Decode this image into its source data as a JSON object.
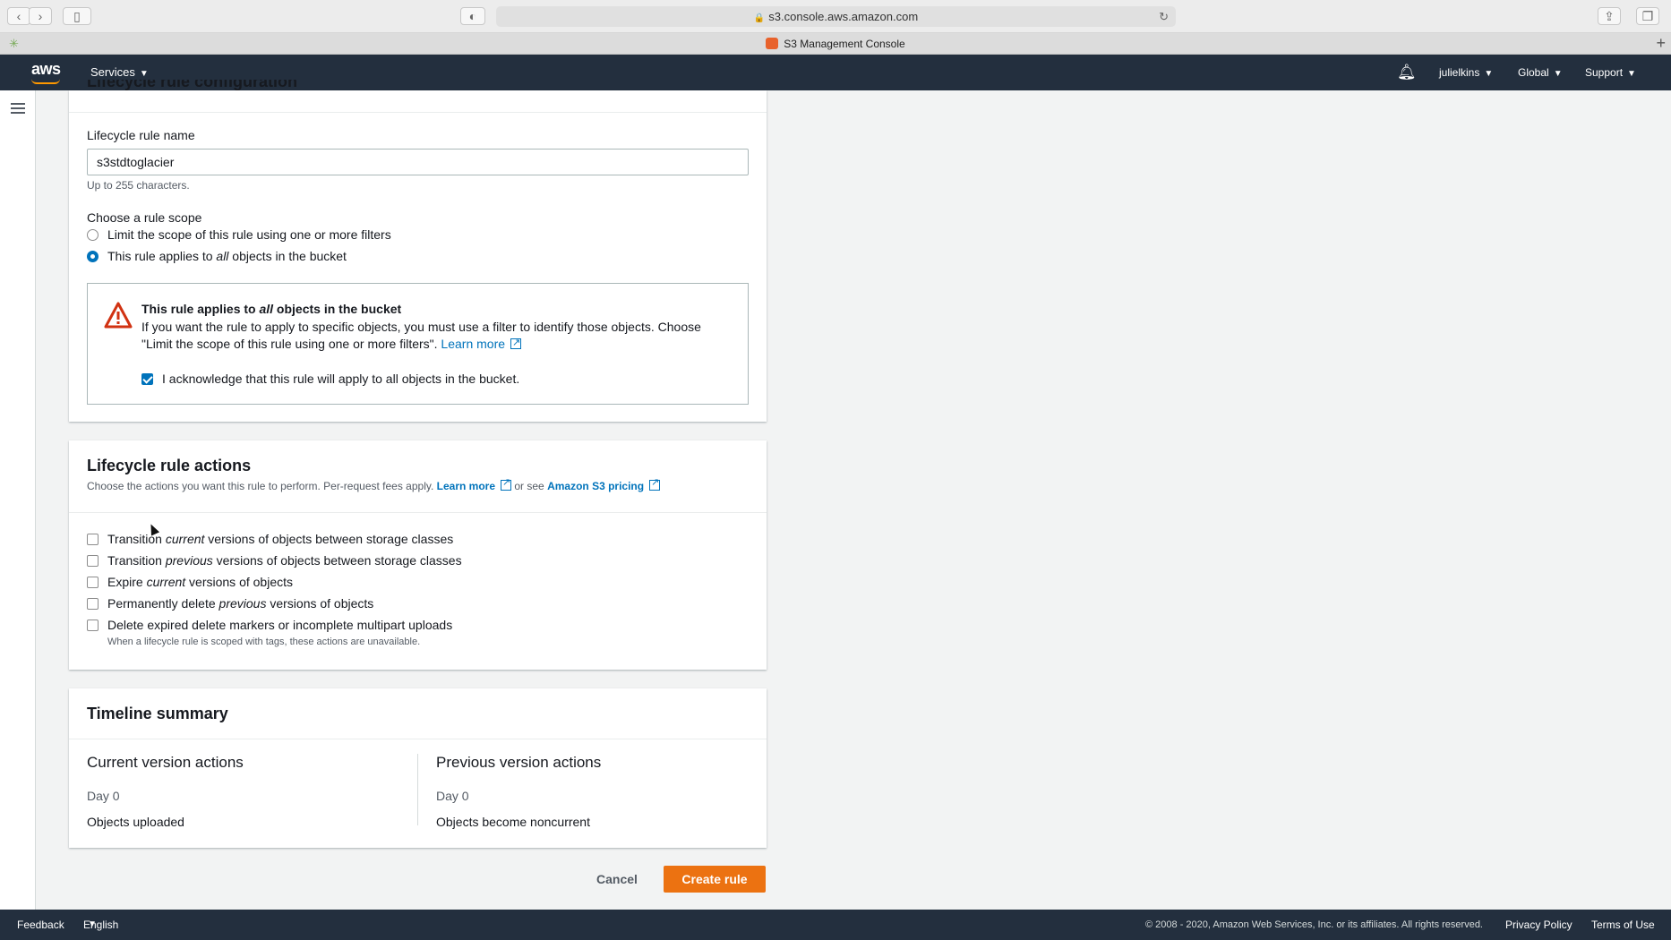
{
  "browser": {
    "url": "s3.console.aws.amazon.com",
    "tab_title": "S3 Management Console"
  },
  "topnav": {
    "logo": "aws",
    "services": "Services",
    "user": "julielkins",
    "region": "Global",
    "support": "Support"
  },
  "rule_config": {
    "partial_title": "Lifecycle rule configuration",
    "name_label": "Lifecycle rule name",
    "name_value": "s3stdtoglacier",
    "name_hint": "Up to 255 characters.",
    "scope_label": "Choose a rule scope",
    "scope_option_filter": "Limit the scope of this rule using one or more filters",
    "scope_option_all_pre": "This rule applies to ",
    "scope_option_all_em": "all",
    "scope_option_all_post": " objects in the bucket",
    "warning": {
      "title_pre": "This rule applies to ",
      "title_em": "all",
      "title_post": " objects in the bucket",
      "text": "If you want the rule to apply to specific objects, you must use a filter to identify those objects. Choose \"Limit the scope of this rule using one or more filters\".",
      "learn_more": "Learn more",
      "ack": "I acknowledge that this rule will apply to all objects in the bucket."
    }
  },
  "actions": {
    "title": "Lifecycle rule actions",
    "desc_pre": "Choose the actions you want this rule to perform. Per-request fees apply.",
    "learn_more": "Learn more",
    "or_see": "or see",
    "pricing": "Amazon S3 pricing",
    "items": [
      {
        "pre": "Transition ",
        "em": "current",
        "post": " versions of objects between storage classes"
      },
      {
        "pre": "Transition ",
        "em": "previous",
        "post": " versions of objects between storage classes"
      },
      {
        "pre": "Expire ",
        "em": "current",
        "post": " versions of objects"
      },
      {
        "pre": "Permanently delete ",
        "em": "previous",
        "post": " versions of objects"
      },
      {
        "pre": "Delete expired delete markers or incomplete multipart uploads",
        "em": "",
        "post": ""
      }
    ],
    "note": "When a lifecycle rule is scoped with tags, these actions are unavailable."
  },
  "timeline": {
    "title": "Timeline summary",
    "current_title": "Current version actions",
    "current_day": "Day 0",
    "current_event": "Objects uploaded",
    "previous_title": "Previous version actions",
    "previous_day": "Day 0",
    "previous_event": "Objects become noncurrent"
  },
  "buttons": {
    "cancel": "Cancel",
    "create": "Create rule"
  },
  "footer": {
    "feedback": "Feedback",
    "language": "English (US)",
    "copyright": "© 2008 - 2020, Amazon Web Services, Inc. or its affiliates. All rights reserved.",
    "privacy": "Privacy Policy",
    "terms": "Terms of Use"
  },
  "colors": {
    "nav_bg": "#232f3e",
    "link": "#0073bb",
    "primary_button": "#ec7211",
    "warning": "#d13212"
  }
}
